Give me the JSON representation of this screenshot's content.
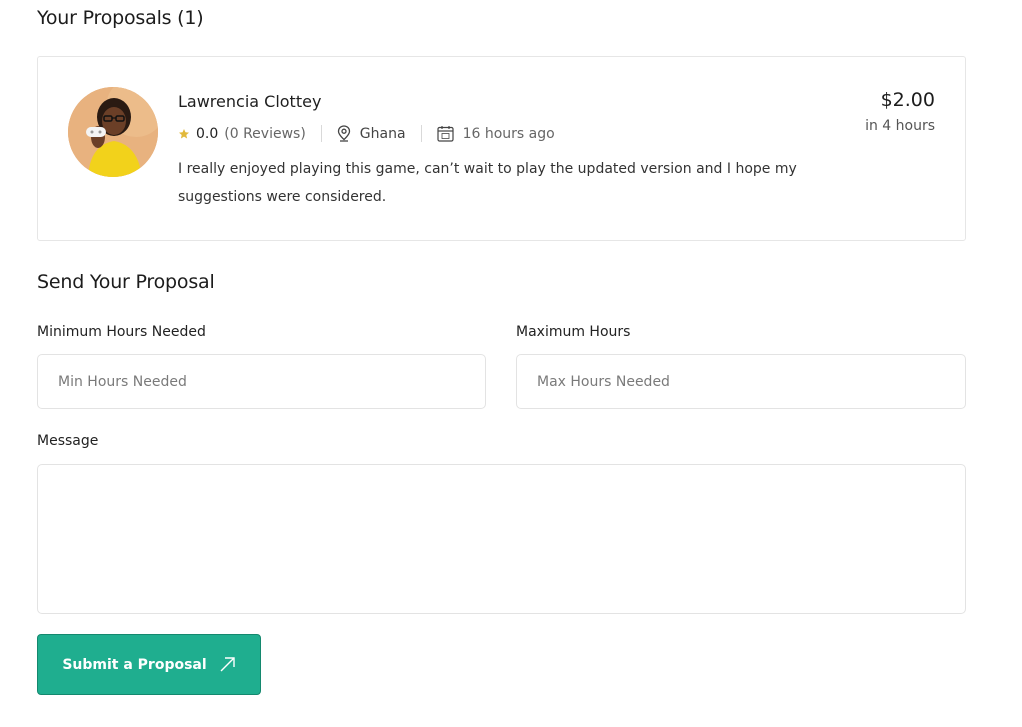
{
  "proposals": {
    "title": "Your Proposals (1)",
    "items": [
      {
        "name": "Lawrencia Clottey",
        "rating": "0.0",
        "reviews": "(0 Reviews)",
        "location": "Ghana",
        "posted": "16 hours ago",
        "comment": "I really enjoyed playing this game, can’t wait to play the updated version and I hope my suggestions were considered.",
        "price": "$2.00",
        "duration": "in 4 hours",
        "icons": {
          "rating": "star-icon",
          "location": "map-pin-icon",
          "posted": "calendar-icon"
        }
      }
    ]
  },
  "form": {
    "title": "Send Your Proposal",
    "min_hours": {
      "label": "Minimum Hours Needed",
      "placeholder": "Min Hours Needed",
      "value": ""
    },
    "max_hours": {
      "label": "Maximum Hours",
      "placeholder": "Max Hours Needed",
      "value": ""
    },
    "message": {
      "label": "Message",
      "placeholder": "",
      "value": ""
    },
    "submit_label": "Submit a Proposal",
    "submit_icon": "arrow-up-right-icon"
  },
  "colors": {
    "accent": "#1fae8f",
    "star": "#e2b93b",
    "border": "#e6e6e6"
  }
}
